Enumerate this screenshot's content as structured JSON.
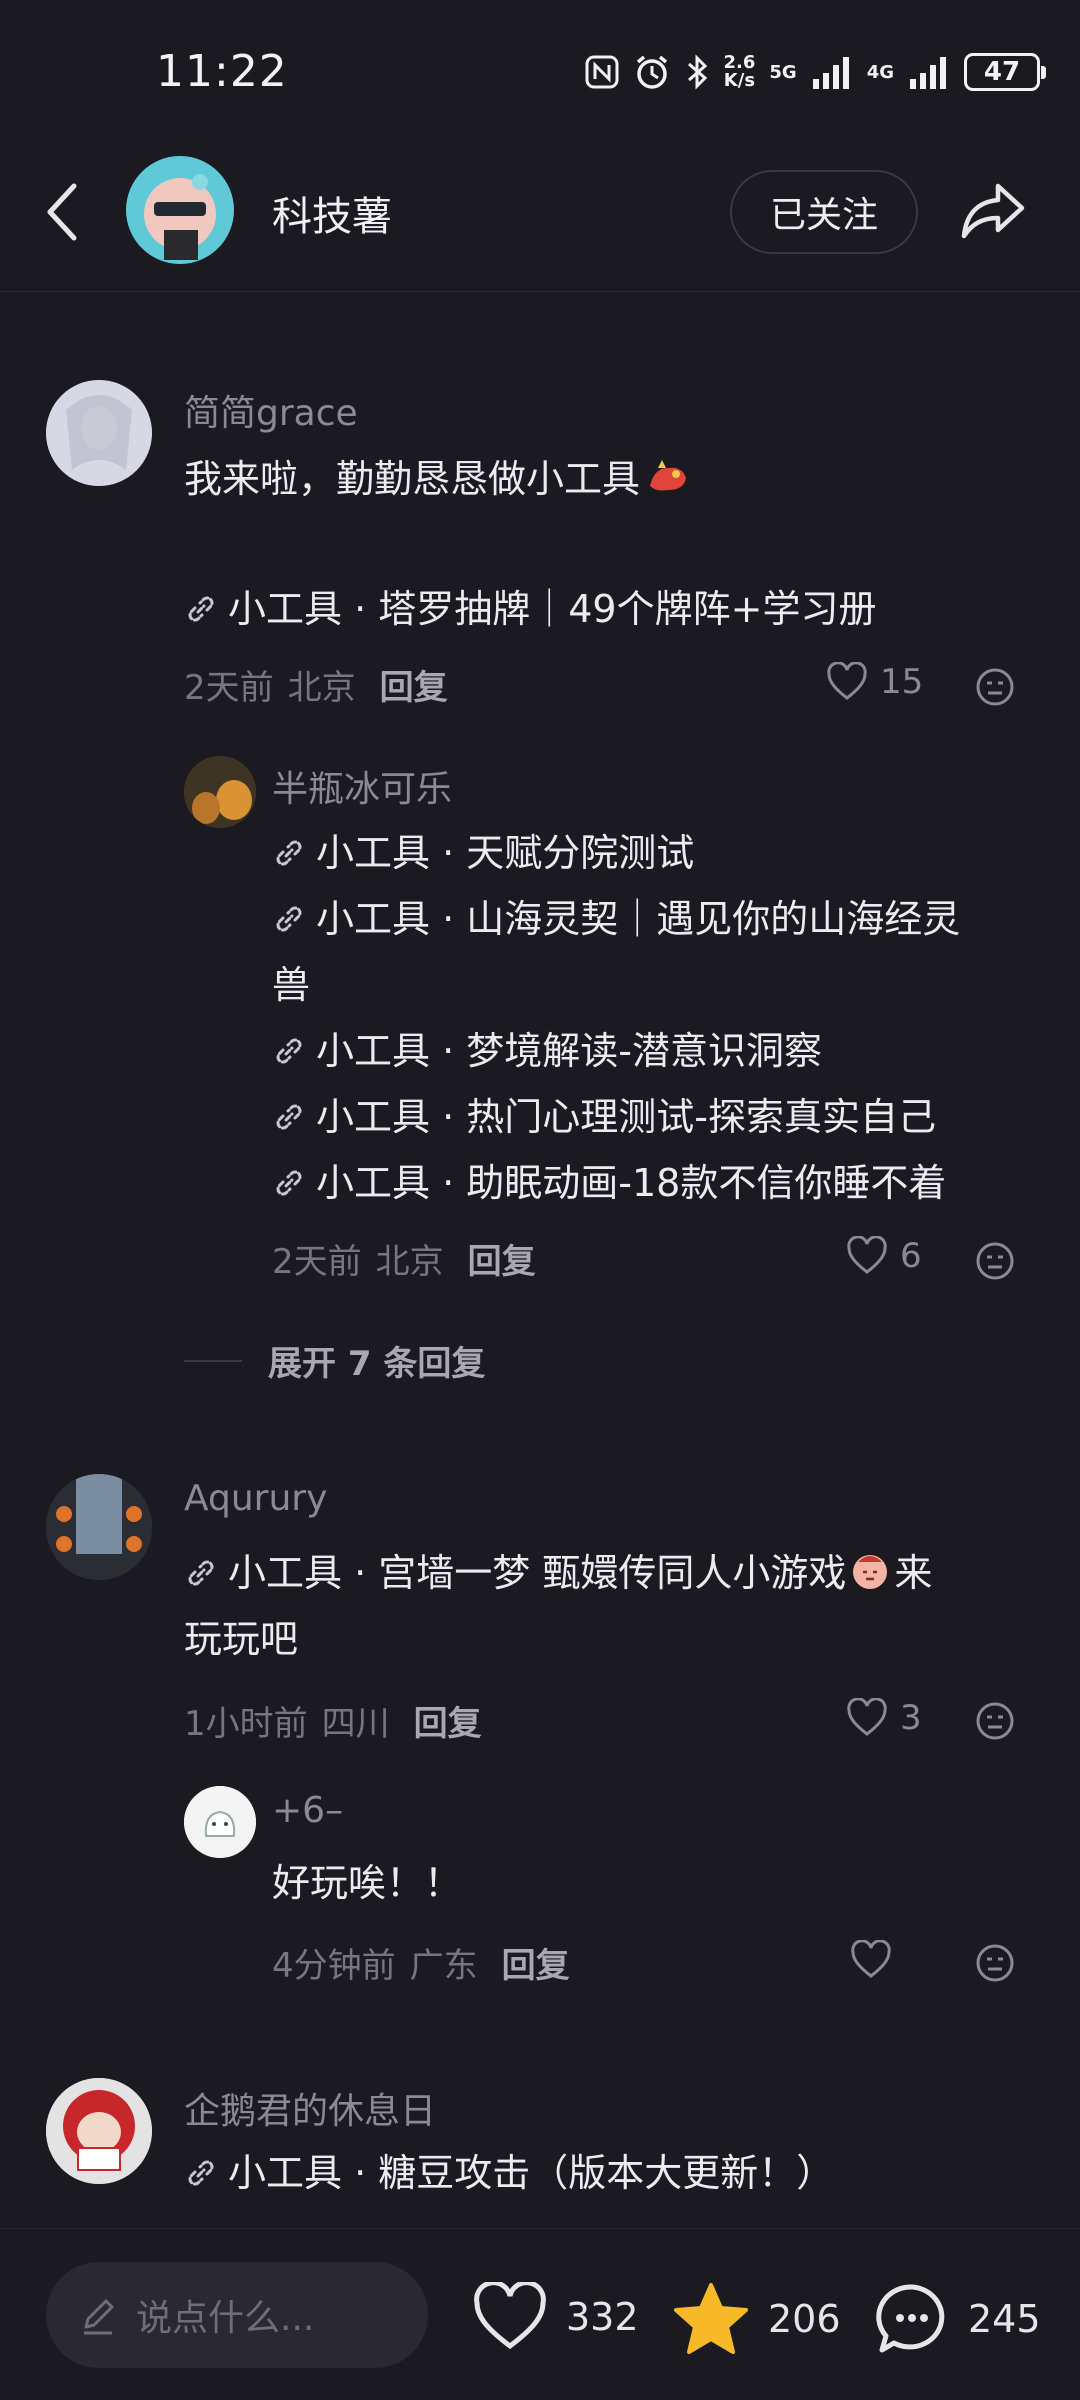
{
  "status_bar": {
    "time": "11:22",
    "speed_value": "2.6",
    "speed_unit": "K/s",
    "net1": "5G",
    "net2": "4G",
    "battery": "47"
  },
  "header": {
    "title": "科技薯",
    "follow_label": "已关注"
  },
  "link_prefix": "小工具 · ",
  "comments": [
    {
      "user": "简简grace",
      "text": "我来啦，勤勤恳恳做小工具",
      "link": "塔罗抽牌｜49个牌阵+学习册",
      "time": "2天前",
      "location": "北京",
      "reply_label": "回复",
      "likes": "15",
      "reply": {
        "user": "半瓶冰可乐",
        "links": [
          "天赋分院测试",
          "山海灵契｜遇见你的山海经灵",
          "梦境解读-潜意识洞察",
          "热门心理测试-探索真实自己",
          "助眠动画-18款不信你睡不着"
        ],
        "link_wrap": "兽",
        "time": "2天前",
        "location": "北京",
        "reply_label": "回复",
        "likes": "6"
      },
      "expand_label": "展开 7 条回复"
    },
    {
      "user": "Aqurury",
      "link": "宫墙一梦 甄嬛传同人小游戏",
      "link_suffix": "来",
      "link_wrap": "玩玩吧",
      "time": "1小时前",
      "location": "四川",
      "reply_label": "回复",
      "likes": "3",
      "reply": {
        "user": "+6–",
        "text": "好玩唉！！",
        "time": "4分钟前",
        "location": "广东",
        "reply_label": "回复",
        "likes": ""
      }
    },
    {
      "user": "企鹅君的休息日",
      "link": "糖豆攻击（版本大更新！）"
    }
  ],
  "bottom_bar": {
    "placeholder": "说点什么...",
    "likes": "332",
    "stars": "206",
    "comments": "245"
  },
  "colors": {
    "background": "#1b1a20",
    "star": "#f7b928",
    "text": "#ecebf0",
    "muted": "#77767e"
  }
}
